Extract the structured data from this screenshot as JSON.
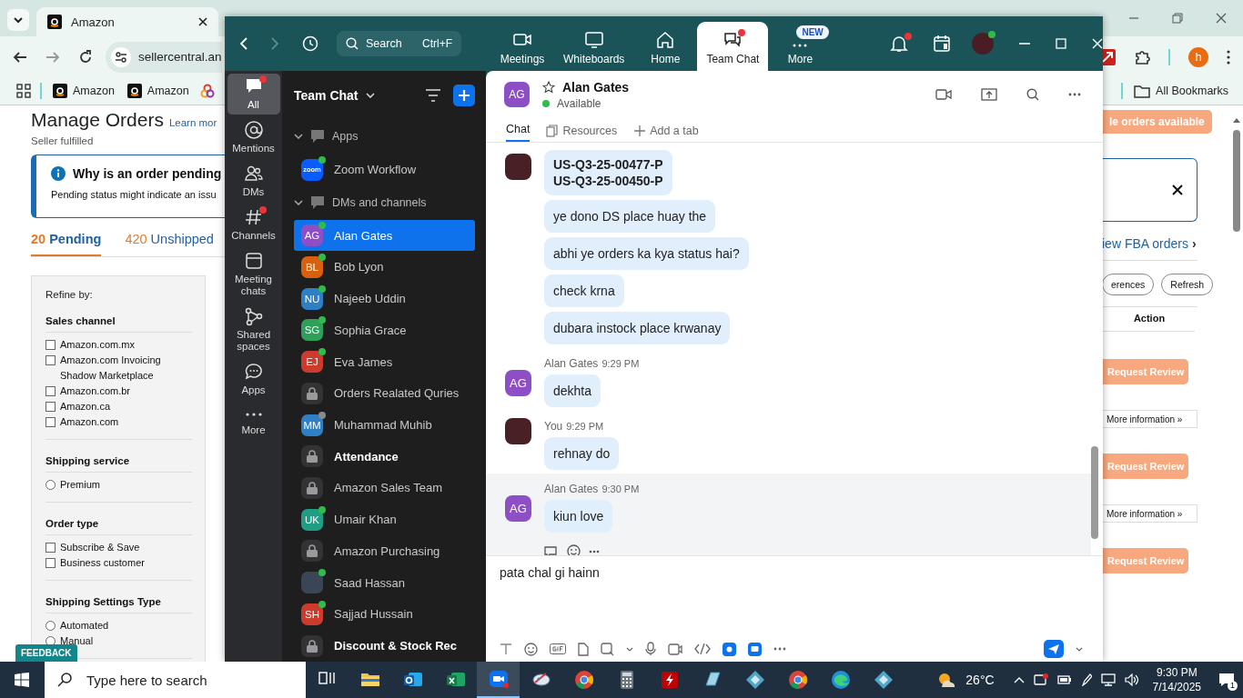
{
  "browser": {
    "tabs": [
      {
        "title": "Amazon",
        "selected": true
      }
    ],
    "address": "sellercentral.an",
    "profile": "h",
    "bookmarks": [
      {
        "label": "Amazon"
      },
      {
        "label": "Amazon"
      }
    ],
    "all_bookmarks": "All Bookmarks"
  },
  "seller_page": {
    "title": "Manage Orders",
    "learn_more": "Learn mor",
    "subtitle": "Seller fulfilled",
    "alert": {
      "title": "Why is an order pending",
      "text": "Pending status might indicate an issu"
    },
    "order_tabs": [
      {
        "count": "20",
        "label": "Pending",
        "selected": true
      },
      {
        "count": "420",
        "label": "Unshipped",
        "selected": false
      }
    ],
    "refine_label": "Refine by:",
    "filter_groups": [
      {
        "title": "Sales channel",
        "options": [
          {
            "kind": "checkbox",
            "label": "Amazon.com.mx",
            "checked": false
          },
          {
            "kind": "checkbox",
            "label": "Amazon.com Invoicing Shadow Marketplace",
            "checked": false
          },
          {
            "kind": "checkbox",
            "label": "Amazon.com.br",
            "checked": false
          },
          {
            "kind": "checkbox",
            "label": "Amazon.ca",
            "checked": false
          },
          {
            "kind": "checkbox",
            "label": "Amazon.com",
            "checked": false
          }
        ]
      },
      {
        "title": "Shipping service",
        "options": [
          {
            "kind": "radio",
            "label": "Premium",
            "checked": false
          }
        ]
      },
      {
        "title": "Order type",
        "options": [
          {
            "kind": "checkbox",
            "label": "Subscribe & Save",
            "checked": false
          },
          {
            "kind": "checkbox",
            "label": "Business customer",
            "checked": false
          }
        ]
      },
      {
        "title": "Shipping Settings Type",
        "options": [
          {
            "kind": "radio",
            "label": "Automated",
            "checked": false
          },
          {
            "kind": "radio",
            "label": "Manual",
            "checked": false
          }
        ]
      }
    ],
    "feedback": "FEEDBACK",
    "available_button": "le orders available",
    "fba_link": "iew FBA orders",
    "fba_chevron": "›",
    "toolbar_buttons": [
      "erences",
      "Refresh"
    ],
    "action_header": "Action",
    "row_actions": [
      {
        "kind": "review",
        "label": "Request Review"
      },
      {
        "kind": "info",
        "label": "More information »"
      },
      {
        "kind": "review",
        "label": "Request Review"
      },
      {
        "kind": "info",
        "label": "More information »"
      },
      {
        "kind": "review",
        "label": "Request Review"
      }
    ]
  },
  "zoom": {
    "search": {
      "placeholder": "Search",
      "shortcut": "Ctrl+F"
    },
    "nav_tabs": [
      {
        "kind": "meetings",
        "label": "Meetings",
        "selected": false
      },
      {
        "kind": "whiteboards",
        "label": "Whiteboards",
        "selected": false
      },
      {
        "kind": "home",
        "label": "Home",
        "selected": false
      },
      {
        "kind": "chat",
        "label": "Team Chat",
        "selected": true,
        "alert": true
      },
      {
        "kind": "more",
        "label": "More",
        "selected": false,
        "badge": "NEW"
      }
    ],
    "notifications_alert": true,
    "rail": [
      {
        "kind": "all",
        "label": "All",
        "selected": true,
        "alert": true
      },
      {
        "kind": "mentions",
        "label": "Mentions",
        "selected": false,
        "alert": false
      },
      {
        "kind": "dms",
        "label": "DMs",
        "selected": false,
        "alert": false
      },
      {
        "kind": "channels",
        "label": "Channels",
        "selected": false,
        "alert": true
      },
      {
        "kind": "meeting",
        "label": "Meeting chats",
        "selected": false,
        "alert": false
      },
      {
        "kind": "spaces",
        "label": "Shared spaces",
        "selected": false,
        "alert": false
      },
      {
        "kind": "apps",
        "label": "Apps",
        "selected": false,
        "alert": false
      },
      {
        "kind": "more",
        "label": "More",
        "selected": false,
        "alert": false
      }
    ],
    "list_title": "Team Chat",
    "sections": [
      {
        "title": "Apps",
        "expanded": true,
        "items": [
          {
            "kind": "app",
            "logo": "zoom",
            "name": "Zoom Workflow",
            "online": true,
            "selected": false,
            "bold": false
          }
        ]
      },
      {
        "title": "DMs and channels",
        "expanded": true,
        "items": [
          {
            "kind": "person",
            "initials": "AG",
            "color": "#8e4fc6",
            "online": true,
            "name": "Alan Gates",
            "selected": true,
            "bold": false
          },
          {
            "kind": "person",
            "initials": "BL",
            "color": "#d9600f",
            "online": true,
            "name": "Bob Lyon",
            "selected": false,
            "bold": false
          },
          {
            "kind": "person",
            "initials": "NU",
            "color": "#2f7fc4",
            "online": true,
            "name": "Najeeb Uddin",
            "selected": false,
            "bold": false
          },
          {
            "kind": "person",
            "initials": "SG",
            "color": "#2ea05a",
            "online": true,
            "name": "Sophia Grace",
            "selected": false,
            "bold": false
          },
          {
            "kind": "person",
            "initials": "EJ",
            "color": "#cc3b2e",
            "online": true,
            "name": "Eva James",
            "selected": false,
            "bold": false
          },
          {
            "kind": "channel",
            "name": "Orders Realated Quries",
            "selected": false,
            "bold": false
          },
          {
            "kind": "person",
            "initials": "MM",
            "color": "#2f7fc4",
            "online": false,
            "name": "Muhammad Muhib",
            "selected": false,
            "bold": false
          },
          {
            "kind": "channel",
            "name": "Attendance",
            "selected": false,
            "bold": true
          },
          {
            "kind": "channel",
            "name": "Amazon Sales Team",
            "selected": false,
            "bold": false
          },
          {
            "kind": "person",
            "initials": "UK",
            "color": "#1f9e84",
            "online": true,
            "name": "Umair Khan",
            "selected": false,
            "bold": false
          },
          {
            "kind": "channel",
            "name": "Amazon Purchasing",
            "selected": false,
            "bold": false
          },
          {
            "kind": "photo",
            "online": true,
            "name": "Saad Hassan",
            "selected": false,
            "bold": false
          },
          {
            "kind": "person",
            "initials": "SH",
            "color": "#cc3b2e",
            "online": true,
            "name": "Sajjad Hussain",
            "selected": false,
            "bold": false
          },
          {
            "kind": "channel",
            "name": "Discount & Stock Rec",
            "selected": false,
            "bold": true
          }
        ]
      }
    ],
    "chat": {
      "contact": {
        "initials": "AG",
        "color": "#8e4fc6",
        "name": "Alan Gates",
        "status": "Available"
      },
      "tabs": [
        {
          "kind": "chat",
          "label": "Chat",
          "selected": true
        },
        {
          "kind": "resources",
          "label": "Resources",
          "selected": false
        },
        {
          "kind": "add",
          "label": "Add a tab",
          "selected": false
        }
      ],
      "messages": [
        {
          "avatar": {
            "kind": "photo"
          },
          "hovered": false,
          "bubbles": [
            {
              "text": "US-Q3-25-00477-P\nUS-Q3-25-00450-P",
              "bold": true
            },
            {
              "text": "ye dono DS place huay the",
              "bold": false
            },
            {
              "text": "abhi ye orders ka kya status hai?",
              "bold": false
            },
            {
              "text": "check krna",
              "bold": false
            },
            {
              "text": "dubara instock place krwanay",
              "bold": false
            }
          ]
        },
        {
          "sender": "Alan Gates",
          "time": "9:29 PM",
          "avatar": {
            "kind": "initials",
            "initials": "AG",
            "color": "#8e4fc6"
          },
          "hovered": false,
          "bubbles": [
            {
              "text": "dekhta",
              "bold": false
            }
          ]
        },
        {
          "sender": "You",
          "time": "9:29 PM",
          "avatar": {
            "kind": "photo"
          },
          "hovered": false,
          "bubbles": [
            {
              "text": "rehnay do",
              "bold": false
            }
          ]
        },
        {
          "sender": "Alan Gates",
          "time": "9:30 PM",
          "avatar": {
            "kind": "initials",
            "initials": "AG",
            "color": "#8e4fc6"
          },
          "hovered": true,
          "bubbles": [
            {
              "text": "kiun love",
              "bold": false
            }
          ]
        }
      ],
      "composer": {
        "value": "pata chal gi hainn"
      }
    }
  },
  "taskbar": {
    "search_placeholder": "Type here to search",
    "apps": [
      {
        "kind": "taskview",
        "selected": false
      },
      {
        "kind": "explorer",
        "selected": false
      },
      {
        "kind": "outlook",
        "selected": false
      },
      {
        "kind": "excel",
        "selected": false
      },
      {
        "kind": "zoom",
        "selected": true
      },
      {
        "kind": "paint",
        "selected": false
      },
      {
        "kind": "chrome",
        "selected": false
      },
      {
        "kind": "calculator",
        "selected": false
      },
      {
        "kind": "filezilla",
        "selected": false
      },
      {
        "kind": "glass",
        "selected": false
      },
      {
        "kind": "diamond",
        "selected": false
      },
      {
        "kind": "chrome",
        "selected": false
      },
      {
        "kind": "edge",
        "selected": false
      },
      {
        "kind": "diamond",
        "selected": false
      }
    ],
    "temperature": "26°C",
    "time": "9:30 PM",
    "date": "7/14/2025",
    "notifications": "1"
  }
}
